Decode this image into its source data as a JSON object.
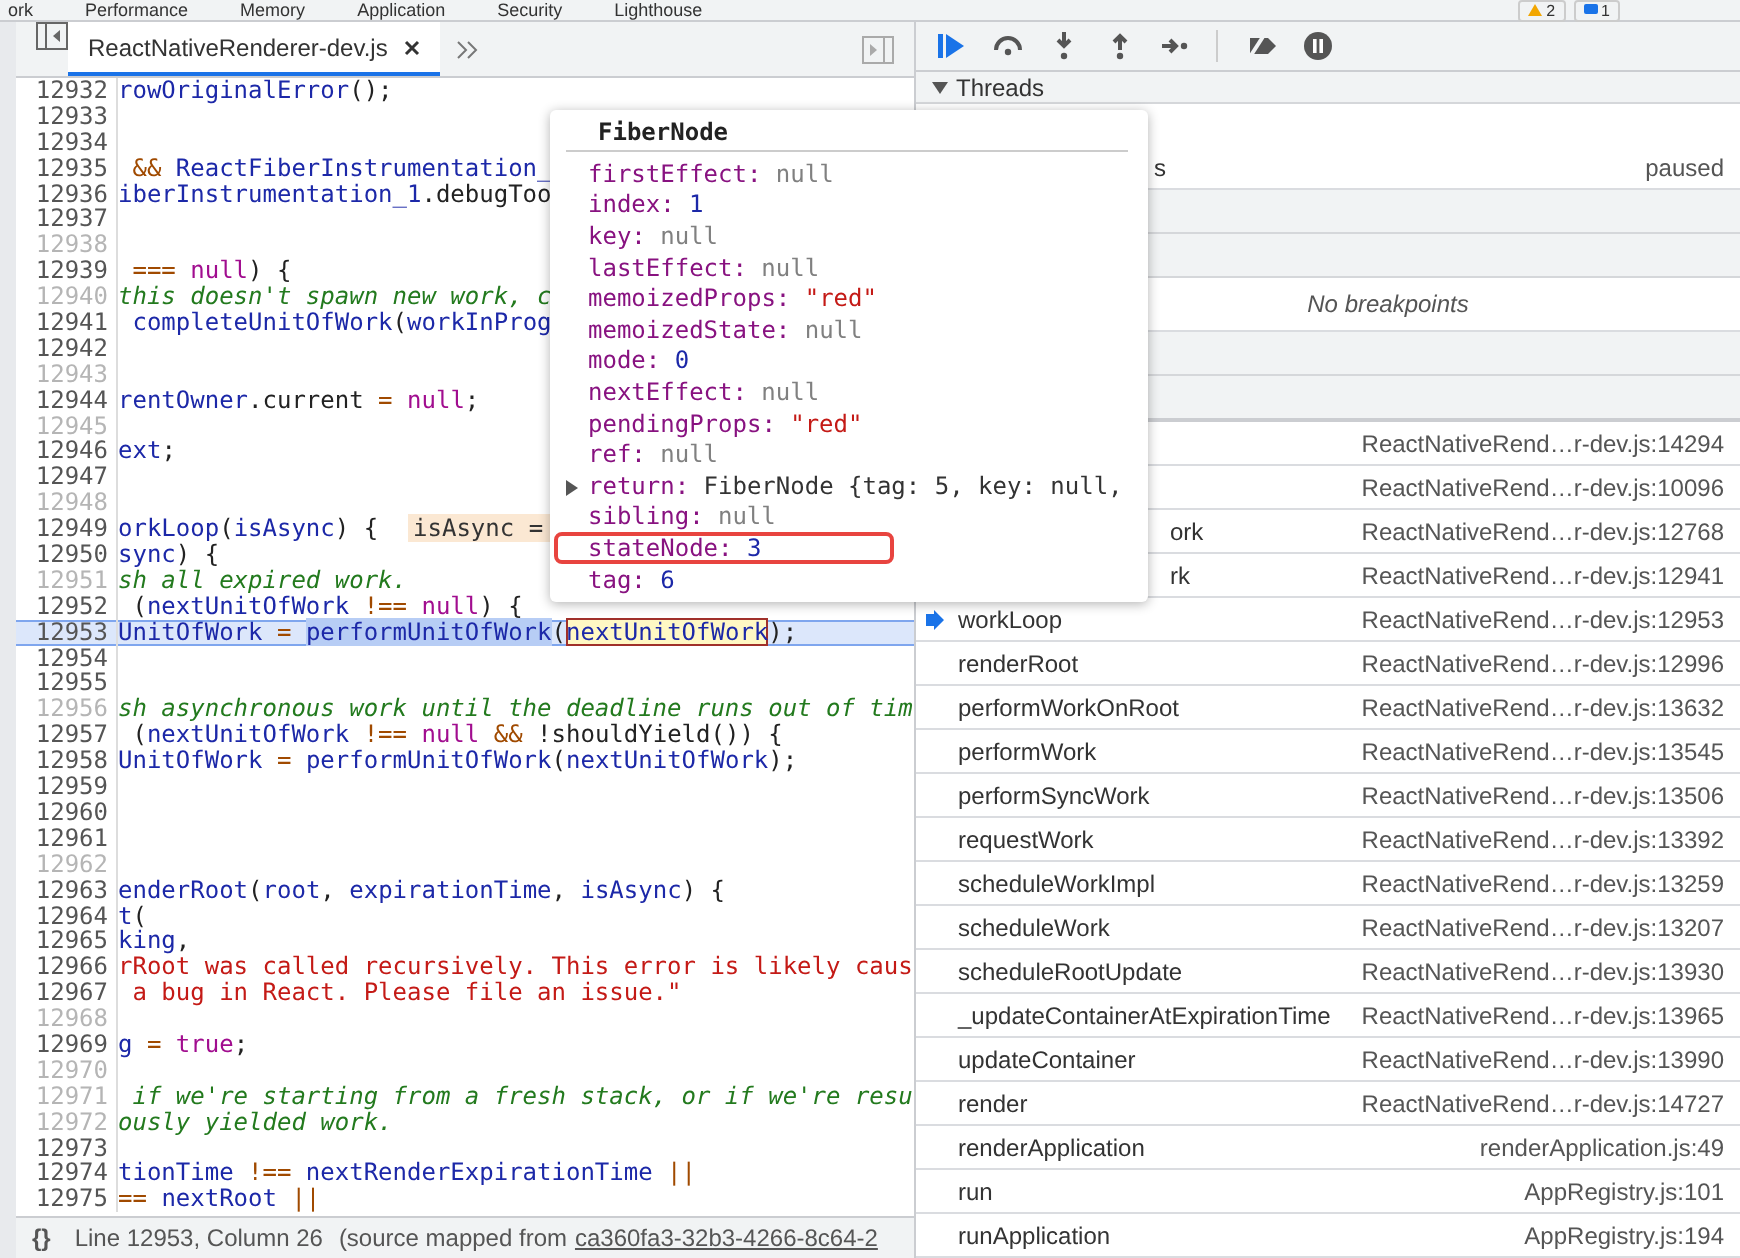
{
  "top_tabs": [
    {
      "label": "ork"
    },
    {
      "label": "Performance"
    },
    {
      "label": "Memory"
    },
    {
      "label": "Application"
    },
    {
      "label": "Security"
    },
    {
      "label": "Lighthouse"
    }
  ],
  "top_badges": [
    {
      "kind": "warning",
      "count": "2"
    },
    {
      "kind": "message",
      "count": "1"
    }
  ],
  "editor": {
    "file_tab": {
      "label": "ReactNativeRenderer-dev.js",
      "selected": true
    },
    "lines": [
      {
        "number": "12932",
        "dim": false,
        "tokens": [
          {
            "text": "rowOriginalError",
            "kind": "id"
          },
          {
            "text": "();",
            "kind": "plain"
          }
        ]
      },
      {
        "number": "12933",
        "dim": false
      },
      {
        "number": "12934",
        "dim": false
      },
      {
        "number": "12935",
        "dim": false,
        "tokens": [
          {
            "text": " && ",
            "kind": "op"
          },
          {
            "text": "ReactFiberInstrumentation_",
            "kind": "id"
          }
        ]
      },
      {
        "number": "12936",
        "dim": false,
        "tokens": [
          {
            "text": "iberInstrumentation_1",
            "kind": "id"
          },
          {
            "text": ".debugToo",
            "kind": "plain"
          }
        ]
      },
      {
        "number": "12937",
        "dim": false
      },
      {
        "number": "12938",
        "dim": true
      },
      {
        "number": "12939",
        "dim": false,
        "tokens": [
          {
            "text": " === ",
            "kind": "op"
          },
          {
            "text": "null",
            "kind": "kw"
          },
          {
            "text": ") {",
            "kind": "plain"
          }
        ]
      },
      {
        "number": "12940",
        "dim": true,
        "tokens": [
          {
            "text": "this doesn't spawn new work, c",
            "kind": "cm"
          }
        ]
      },
      {
        "number": "12941",
        "dim": false,
        "tokens": [
          {
            "text": " completeUnitOfWork",
            "kind": "id"
          },
          {
            "text": "(",
            "kind": "plain"
          },
          {
            "text": "workInProg",
            "kind": "id"
          }
        ]
      },
      {
        "number": "12942",
        "dim": false
      },
      {
        "number": "12943",
        "dim": true
      },
      {
        "number": "12944",
        "dim": false,
        "tokens": [
          {
            "text": "rentOwner",
            "kind": "id"
          },
          {
            "text": ".current",
            "kind": "plain"
          },
          {
            "text": " = ",
            "kind": "op"
          },
          {
            "text": "null",
            "kind": "kw"
          },
          {
            "text": ";",
            "kind": "plain"
          }
        ]
      },
      {
        "number": "12945",
        "dim": true
      },
      {
        "number": "12946",
        "dim": false,
        "tokens": [
          {
            "text": "ext",
            "kind": "id"
          },
          {
            "text": ";",
            "kind": "plain"
          }
        ]
      },
      {
        "number": "12947",
        "dim": false
      },
      {
        "number": "12948",
        "dim": true
      },
      {
        "number": "12949",
        "dim": false,
        "tokens": [
          {
            "text": "orkLoop",
            "kind": "id"
          },
          {
            "text": "(",
            "kind": "plain"
          },
          {
            "text": "isAsync",
            "kind": "id"
          },
          {
            "text": ") {  ",
            "kind": "plain"
          },
          {
            "text": "isAsync =",
            "kind": "inline"
          }
        ]
      },
      {
        "number": "12950",
        "dim": false,
        "tokens": [
          {
            "text": "sync",
            "kind": "id"
          },
          {
            "text": ") {",
            "kind": "plain"
          }
        ]
      },
      {
        "number": "12951",
        "dim": true,
        "tokens": [
          {
            "text": "sh all expired work.",
            "kind": "cm"
          }
        ]
      },
      {
        "number": "12952",
        "dim": false,
        "tokens": [
          {
            "text": " (",
            "kind": "plain"
          },
          {
            "text": "nextUnitOfWork",
            "kind": "id"
          },
          {
            "text": " !== ",
            "kind": "op"
          },
          {
            "text": "null",
            "kind": "kw"
          },
          {
            "text": ") {",
            "kind": "plain"
          }
        ]
      },
      {
        "number": "12953",
        "dim": false,
        "current": true,
        "tokens": [
          {
            "text": "UnitOfWork",
            "kind": "id"
          },
          {
            "text": " = ",
            "kind": "op"
          },
          {
            "text": "performUnitOfWork",
            "kind": "selection"
          },
          {
            "text": "(",
            "kind": "plain"
          },
          {
            "text": "nextUnitOfWork",
            "kind": "hover"
          },
          {
            "text": ");",
            "kind": "plain"
          }
        ]
      },
      {
        "number": "12954",
        "dim": false
      },
      {
        "number": "12955",
        "dim": false
      },
      {
        "number": "12956",
        "dim": true,
        "tokens": [
          {
            "text": "sh asynchronous work until the deadline runs out of tim",
            "kind": "cm"
          }
        ]
      },
      {
        "number": "12957",
        "dim": false,
        "tokens": [
          {
            "text": " (",
            "kind": "plain"
          },
          {
            "text": "nextUnitOfWork",
            "kind": "id"
          },
          {
            "text": " !== ",
            "kind": "op"
          },
          {
            "text": "null",
            "kind": "kw"
          },
          {
            "text": " && ",
            "kind": "op"
          },
          {
            "text": "!shouldYield()) {",
            "kind": "plain"
          }
        ]
      },
      {
        "number": "12958",
        "dim": false,
        "tokens": [
          {
            "text": "UnitOfWork",
            "kind": "id"
          },
          {
            "text": " = ",
            "kind": "op"
          },
          {
            "text": "performUnitOfWork",
            "kind": "id"
          },
          {
            "text": "(",
            "kind": "plain"
          },
          {
            "text": "nextUnitOfWork",
            "kind": "id"
          },
          {
            "text": ");",
            "kind": "plain"
          }
        ]
      },
      {
        "number": "12959",
        "dim": false
      },
      {
        "number": "12960",
        "dim": false
      },
      {
        "number": "12961",
        "dim": false
      },
      {
        "number": "12962",
        "dim": true
      },
      {
        "number": "12963",
        "dim": false,
        "tokens": [
          {
            "text": "enderRoot",
            "kind": "id"
          },
          {
            "text": "(",
            "kind": "plain"
          },
          {
            "text": "root",
            "kind": "id"
          },
          {
            "text": ", ",
            "kind": "plain"
          },
          {
            "text": "expirationTime",
            "kind": "id"
          },
          {
            "text": ", ",
            "kind": "plain"
          },
          {
            "text": "isAsync",
            "kind": "id"
          },
          {
            "text": ") {",
            "kind": "plain"
          }
        ]
      },
      {
        "number": "12964",
        "dim": false,
        "tokens": [
          {
            "text": "t",
            "kind": "id"
          },
          {
            "text": "(",
            "kind": "plain"
          }
        ]
      },
      {
        "number": "12965",
        "dim": false,
        "tokens": [
          {
            "text": "king",
            "kind": "id"
          },
          {
            "text": ",",
            "kind": "plain"
          }
        ]
      },
      {
        "number": "12966",
        "dim": false,
        "tokens": [
          {
            "text": "rRoot was called recursively. This error is likely caus",
            "kind": "str"
          }
        ]
      },
      {
        "number": "12967",
        "dim": false,
        "tokens": [
          {
            "text": " a bug in React. Please file an issue.\"",
            "kind": "str"
          }
        ]
      },
      {
        "number": "12968",
        "dim": true
      },
      {
        "number": "12969",
        "dim": false,
        "tokens": [
          {
            "text": "g",
            "kind": "id"
          },
          {
            "text": " = ",
            "kind": "op"
          },
          {
            "text": "true",
            "kind": "kw"
          },
          {
            "text": ";",
            "kind": "plain"
          }
        ]
      },
      {
        "number": "12970",
        "dim": true
      },
      {
        "number": "12971",
        "dim": true,
        "tokens": [
          {
            "text": " if we're starting from a fresh stack, or if we're resu",
            "kind": "cm"
          }
        ]
      },
      {
        "number": "12972",
        "dim": true,
        "tokens": [
          {
            "text": "ously yielded work.",
            "kind": "cm"
          }
        ]
      },
      {
        "number": "12973",
        "dim": false
      },
      {
        "number": "12974",
        "dim": false,
        "tokens": [
          {
            "text": "tionTime",
            "kind": "id"
          },
          {
            "text": " !== ",
            "kind": "op"
          },
          {
            "text": "nextRenderExpirationTime",
            "kind": "id"
          },
          {
            "text": " ||",
            "kind": "op"
          }
        ]
      },
      {
        "number": "12975",
        "dim": false,
        "tokens": [
          {
            "text": "== ",
            "kind": "op"
          },
          {
            "text": "nextRoot",
            "kind": "id"
          },
          {
            "text": " ||",
            "kind": "op"
          }
        ]
      }
    ]
  },
  "status_bar": {
    "format_icon": "{}",
    "position": "Line 12953, Column 26",
    "source_prefix": "(source mapped from",
    "source_link": "ca360fa3-32b3-4266-8c64-2"
  },
  "popover": {
    "title": "FiberNode",
    "properties": [
      {
        "name": "firstEffect:",
        "value": "null",
        "kind": "null",
        "expandable": false,
        "highlighted": false
      },
      {
        "name": "index:",
        "value": "1",
        "kind": "number",
        "expandable": false,
        "highlighted": false
      },
      {
        "name": "key:",
        "value": "null",
        "kind": "null",
        "expandable": false,
        "highlighted": false
      },
      {
        "name": "lastEffect:",
        "value": "null",
        "kind": "null",
        "expandable": false,
        "highlighted": false
      },
      {
        "name": "memoizedProps:",
        "value": "\"red\"",
        "kind": "string",
        "expandable": false,
        "highlighted": false
      },
      {
        "name": "memoizedState:",
        "value": "null",
        "kind": "null",
        "expandable": false,
        "highlighted": false
      },
      {
        "name": "mode:",
        "value": "0",
        "kind": "number",
        "expandable": false,
        "highlighted": false
      },
      {
        "name": "nextEffect:",
        "value": "null",
        "kind": "null",
        "expandable": false,
        "highlighted": false
      },
      {
        "name": "pendingProps:",
        "value": "\"red\"",
        "kind": "string",
        "expandable": false,
        "highlighted": false
      },
      {
        "name": "ref:",
        "value": "null",
        "kind": "null",
        "expandable": false,
        "highlighted": false
      },
      {
        "name": "return:",
        "value": "FiberNode {tag: 5, key: null,",
        "kind": "object",
        "expandable": true,
        "highlighted": false
      },
      {
        "name": "sibling:",
        "value": "null",
        "kind": "null",
        "expandable": false,
        "highlighted": false
      },
      {
        "name": "stateNode:",
        "value": "3",
        "kind": "number",
        "expandable": false,
        "highlighted": true
      },
      {
        "name": "tag:",
        "value": "6",
        "kind": "number",
        "expandable": false,
        "highlighted": false
      }
    ]
  },
  "debugger": {
    "threads": {
      "title": "Threads",
      "expanded": true,
      "rows": [
        {
          "name": "s",
          "status": "paused",
          "clipped": true
        }
      ]
    },
    "breakpoints_message": "No breakpoints",
    "call_stack": [
      {
        "location": "ReactNativeRend…r-dev.js:14294"
      },
      {
        "location": "ReactNativeRend…r-dev.js:10096"
      },
      {
        "name": "ork",
        "location": "ReactNativeRend…r-dev.js:12768",
        "current": false,
        "clipped": true
      },
      {
        "name": "rk",
        "location": "ReactNativeRend…r-dev.js:12941",
        "current": false,
        "clipped": true
      },
      {
        "name": "workLoop",
        "location": "ReactNativeRend…r-dev.js:12953",
        "current": true,
        "clipped": false
      },
      {
        "name": "renderRoot",
        "location": "ReactNativeRend…r-dev.js:12996",
        "current": false,
        "clipped": false
      },
      {
        "name": "performWorkOnRoot",
        "location": "ReactNativeRend…r-dev.js:13632",
        "current": false,
        "clipped": false
      },
      {
        "name": "performWork",
        "location": "ReactNativeRend…r-dev.js:13545",
        "current": false,
        "clipped": false
      },
      {
        "name": "performSyncWork",
        "location": "ReactNativeRend…r-dev.js:13506",
        "current": false,
        "clipped": false
      },
      {
        "name": "requestWork",
        "location": "ReactNativeRend…r-dev.js:13392",
        "current": false,
        "clipped": false
      },
      {
        "name": "scheduleWorkImpl",
        "location": "ReactNativeRend…r-dev.js:13259",
        "current": false,
        "clipped": false
      },
      {
        "name": "scheduleWork",
        "location": "ReactNativeRend…r-dev.js:13207",
        "current": false,
        "clipped": false
      },
      {
        "name": "scheduleRootUpdate",
        "location": "ReactNativeRend…r-dev.js:13930",
        "current": false,
        "clipped": false
      },
      {
        "name": "_updateContainerAtExpirationTime",
        "location": "ReactNativeRend…r-dev.js:13965",
        "current": false,
        "clipped": false
      },
      {
        "name": "updateContainer",
        "location": "ReactNativeRend…r-dev.js:13990",
        "current": false,
        "clipped": false
      },
      {
        "name": "render",
        "location": "ReactNativeRend…r-dev.js:14727",
        "current": false,
        "clipped": false
      },
      {
        "name": "renderApplication",
        "location": "renderApplication.js:49",
        "current": false,
        "clipped": false
      },
      {
        "name": "run",
        "location": "AppRegistry.js:101",
        "current": false,
        "clipped": false
      },
      {
        "name": "runApplication",
        "location": "AppRegistry.js:194",
        "current": false,
        "clipped": false
      }
    ]
  }
}
